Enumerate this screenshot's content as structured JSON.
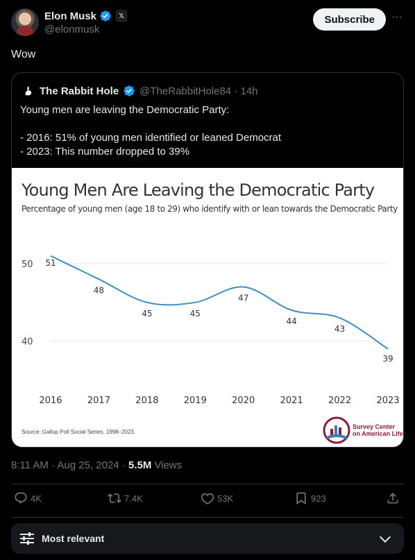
{
  "author": {
    "name": "Elon Musk",
    "handle": "@elonmusk",
    "badge_glyph": "𝕏"
  },
  "header": {
    "subscribe_label": "Subscribe",
    "more_label": "···"
  },
  "post": {
    "text": "Wow"
  },
  "quote": {
    "name": "The Rabbit Hole",
    "handle_time": "@TheRabbitHole84 · 14h",
    "text": "Young men are leaving the Democratic Party:\n\n- 2016: 51% of young men identified or leaned Democrat\n- 2023: This number dropped to 39%"
  },
  "chart_data": {
    "type": "line",
    "title": "Young Men Are Leaving the Democratic Party",
    "subtitle": "Percentage of young men (age 18 to 29) who identify with or lean towards the Democratic Party",
    "x": [
      "2016",
      "2017",
      "2018",
      "2019",
      "2020",
      "2021",
      "2022",
      "2023"
    ],
    "series": [
      {
        "values": [
          51,
          48,
          45,
          45,
          47,
          44,
          43,
          39
        ],
        "color": "#3a8fc2"
      }
    ],
    "yticks": [
      40,
      50
    ],
    "ylim": [
      35.5,
      52.5
    ],
    "grid": true,
    "source": "Source: Gallup Poll Social Series, 1998–2023.",
    "logo_text_line1": "Survey Center",
    "logo_text_line2": "on American Life"
  },
  "meta": {
    "timestamp": "8:11 AM · Aug 25, 2024 · ",
    "views_count": "5.5M",
    "views_label": " Views"
  },
  "actions": {
    "replies": "4K",
    "reposts": "7.4K",
    "likes": "53K",
    "bookmarks": "923"
  },
  "sort": {
    "label": "Most relevant"
  },
  "colors": {
    "verified": "#1d9bf0",
    "line": "#3a8fc2",
    "muted": "#71767b"
  }
}
